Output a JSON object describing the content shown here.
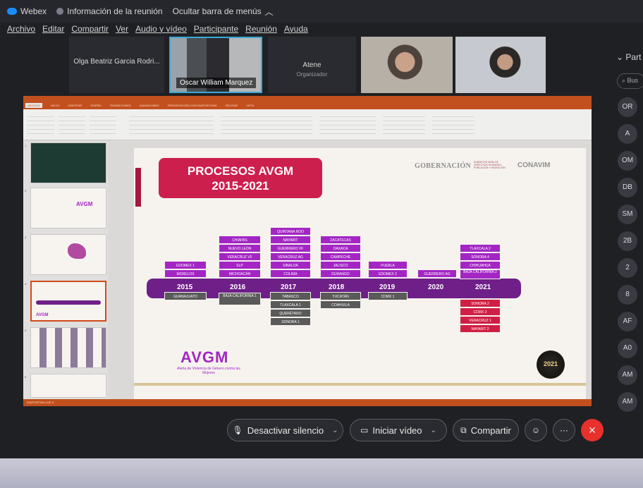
{
  "titlebar": {
    "app_name": "Webex",
    "meeting_info": "Información de la reunión",
    "hide_menu": "Ocultar barra de menús"
  },
  "menubar": [
    "Archivo",
    "Editar",
    "Compartir",
    "Ver",
    "Audio y vídeo",
    "Participante",
    "Reunión",
    "Ayuda"
  ],
  "participants_strip": {
    "tile1_name": "Olga Beatriz Garcia Rodri...",
    "tile2_name": "Oscar William Marquez",
    "tile3_name": "Atene",
    "tile3_role": "Organizador"
  },
  "panel": {
    "title": "Part",
    "search_placeholder": "Bus",
    "avatars": [
      "OR",
      "A",
      "OM",
      "DB",
      "SM",
      "2B",
      "2",
      "8",
      "AF",
      "A0",
      "AM",
      "AM"
    ]
  },
  "ppt": {
    "tabs": [
      "ARCHIVO",
      "INICIO",
      "INSERTAR",
      "DISEÑO",
      "TRANSICIONES",
      "ANIMACIONES",
      "PRESENTACIÓN CON DIAPOSITIVAS",
      "REVISAR",
      "VISTA"
    ],
    "thumb_numbers": [
      "1",
      "2",
      "3",
      "4",
      "5",
      "6"
    ],
    "thumb2_label": "AVGM",
    "thumb4_label": "AVGM",
    "status_text": "DIAPOSITIVA 4 DE 6"
  },
  "slide": {
    "title_line1": "PROCESOS AVGM",
    "title_line2": "2015-2021",
    "gobernacion": "GOBERNACIÓN",
    "gob_sub": "SUBSECRETARÍA DE DERECHOS HUMANOS, POBLACIÓN Y MIGRACIÓN",
    "conavim": "CONAVIM",
    "avgm_logo": "AVGM",
    "avgm_sub": "Alerta de Violencia de Género contra las Mujeres",
    "seal_text": "2021",
    "years": [
      "2015",
      "2016",
      "2017",
      "2018",
      "2019",
      "2020",
      "2021"
    ],
    "above": {
      "2015": [
        "EDOMEX 1",
        "MORELOS"
      ],
      "2016": [
        "CHIAPAS",
        "NUEVO LEÓN",
        "VERACRUZ VF",
        "SLP",
        "MICHOACÁN"
      ],
      "2017": [
        "QUINTANA ROO",
        "NAYARIT",
        "GUERRERO VF",
        "VERACRUZ AG",
        "SINALOA",
        "COLIMA"
      ],
      "2018": [
        "ZACATECAS",
        "OAXACA",
        "CAMPECHE",
        "JALISCO",
        "DURANGO"
      ],
      "2019": [
        "PUEBLA",
        "EDOMEX 2"
      ],
      "2020": [
        "GUERRERO AG"
      ],
      "2021": [
        "TLAXCALA 2",
        "SONORA 4",
        "CHIHUAHUA",
        "BAJA CALIFORNIA 2"
      ]
    },
    "below_gray": {
      "2015": [
        "GUANAJUATO"
      ],
      "2016": [
        "BAJA CALIFORNIA 1"
      ],
      "2017": [
        "TABASCO",
        "TLAXCALA 1",
        "QUERÉTARO",
        "SONORA 1"
      ],
      "2018": [
        "YUCATÁN",
        "COAHUILA"
      ],
      "2019": [
        "CDMX 1"
      ]
    },
    "below_red": {
      "2021": [
        "SONORA 2",
        "CDMX 2",
        "VERACRUZ 1",
        "NAYARIT 2"
      ]
    }
  },
  "controls": {
    "mute": "Desactivar silencio",
    "video": "Iniciar vídeo",
    "share": "Compartir"
  }
}
